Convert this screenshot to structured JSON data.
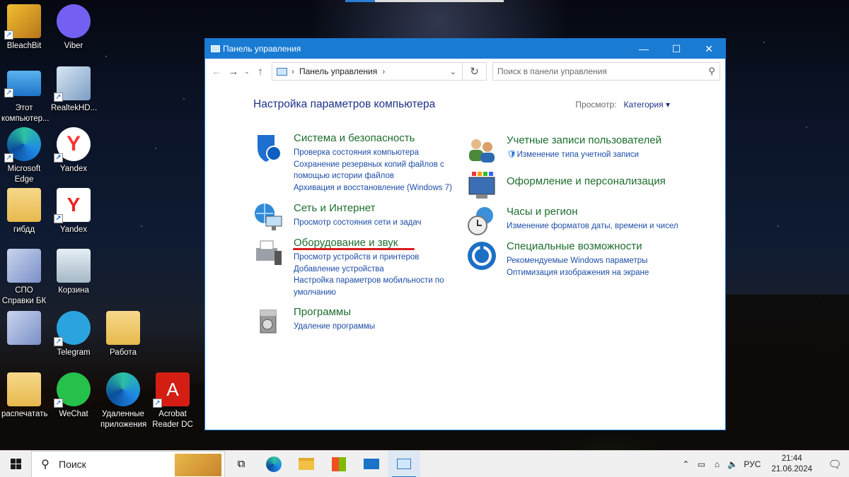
{
  "desktop": {
    "icons": [
      {
        "label": "BleachBit",
        "icon": "bleachbit-icon"
      },
      {
        "label": "Viber",
        "icon": "viber-icon"
      },
      {
        "label": "Этот компьютер...",
        "icon": "this-pc-icon"
      },
      {
        "label": "RealtekHD...",
        "icon": "realtek-icon"
      },
      {
        "label": "Microsoft Edge",
        "icon": "edge-icon"
      },
      {
        "label": "Yandex",
        "icon": "yandex-browser-icon"
      },
      {
        "label": "гибдд",
        "icon": "folder-icon"
      },
      {
        "label": "Yandex",
        "icon": "yandex-icon"
      },
      {
        "label": "СПО Справки БК",
        "icon": "spo-icon"
      },
      {
        "label": "Корзина",
        "icon": "recycle-bin-icon"
      },
      {
        "label": "",
        "icon": "spo-icon"
      },
      {
        "label": "Telegram",
        "icon": "telegram-icon"
      },
      {
        "label": "Работа",
        "icon": "folder-icon"
      },
      {
        "label": "распечатать",
        "icon": "folder-icon"
      },
      {
        "label": "WeChat",
        "icon": "wechat-icon"
      },
      {
        "label": "Удаленные приложения",
        "icon": "edge-icon"
      },
      {
        "label": "Acrobat Reader DC",
        "icon": "acrobat-icon"
      }
    ]
  },
  "window": {
    "title": "Панель управления",
    "address": "Панель управления",
    "search_placeholder": "Поиск в панели управления",
    "heading": "Настройка параметров компьютера",
    "view_label": "Просмотр:",
    "view_value": "Категория",
    "categories": [
      {
        "title": "Система и безопасность",
        "links": [
          "Проверка состояния компьютера",
          "Сохранение резервных копий файлов с",
          "помощью истории файлов",
          "Архивация и восстановление (Windows 7)"
        ]
      },
      {
        "title": "Сеть и Интернет",
        "links": [
          "Просмотр состояния сети и задач"
        ]
      },
      {
        "title": "Оборудование и звук",
        "links": [
          "Просмотр устройств и принтеров",
          "Добавление устройства",
          "Настройка параметров мобильности по",
          "умолчанию"
        ]
      },
      {
        "title": "Программы",
        "links": [
          "Удаление программы"
        ]
      },
      {
        "title": "Учетные записи пользователей",
        "links": [
          "Изменение типа учетной записи"
        ]
      },
      {
        "title": "Оформление и персонализация",
        "links": []
      },
      {
        "title": "Часы и регион",
        "links": [
          "Изменение форматов даты, времени и чисел"
        ]
      },
      {
        "title": "Специальные возможности",
        "links": [
          "Рекомендуемые Windows параметры",
          "Оптимизация изображения на экране"
        ]
      }
    ]
  },
  "taskbar": {
    "search_text": "Поиск",
    "language": "РУС",
    "time": "21:44",
    "date": "21.06.2024"
  },
  "colors": {
    "accent": "#1a7bd3",
    "category_title": "#1d6e2e",
    "link": "#1e4ea8",
    "highlight_underline": "#d91b1b"
  }
}
